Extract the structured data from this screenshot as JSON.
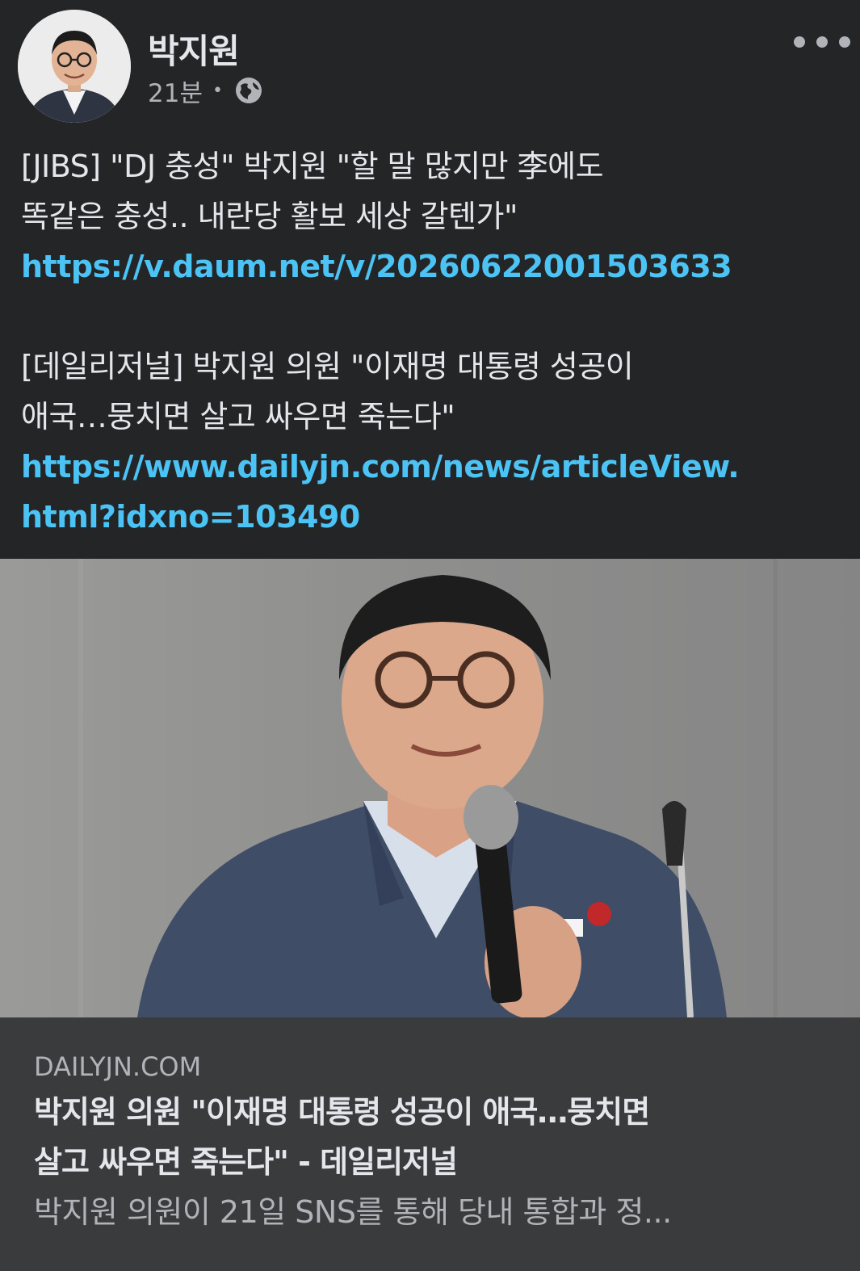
{
  "post": {
    "author": "박지원",
    "time": "21분",
    "separator": "•",
    "privacy_icon": "globe-icon",
    "more_icon": "more-options-icon"
  },
  "content": {
    "para1_line1": "[JIBS] \"DJ 충성\" 박지원 \"할 말 많지만 李에도",
    "para1_line2": "똑같은 충성.. 내란당 활보 세상 갈텐가\"",
    "link1": "https://v.daum.net/v/20260622001503633",
    "para2_line1": "[데일리저널] 박지원 의원 \"이재명 대통령 성공이",
    "para2_line2": "애국…뭉치면 살고 싸우면 죽는다\"",
    "link2_line1": "https://www.dailyjn.com/news/articleView.",
    "link2_line2": "html?idxno=103490"
  },
  "preview": {
    "domain": "DAILYJN.COM",
    "title_line1": "박지원 의원 \"이재명 대통령 성공이 애국…뭉치면",
    "title_line2": "살고 싸우면 죽는다\" - 데일리저널",
    "description": "박지원 의원이 21일 SNS를 통해 당내 통합과 정..."
  },
  "colors": {
    "background": "#242526",
    "text": "#e4e6eb",
    "secondary_text": "#b0b3b8",
    "link": "#4cc3f5",
    "preview_bg": "#3a3b3c"
  }
}
